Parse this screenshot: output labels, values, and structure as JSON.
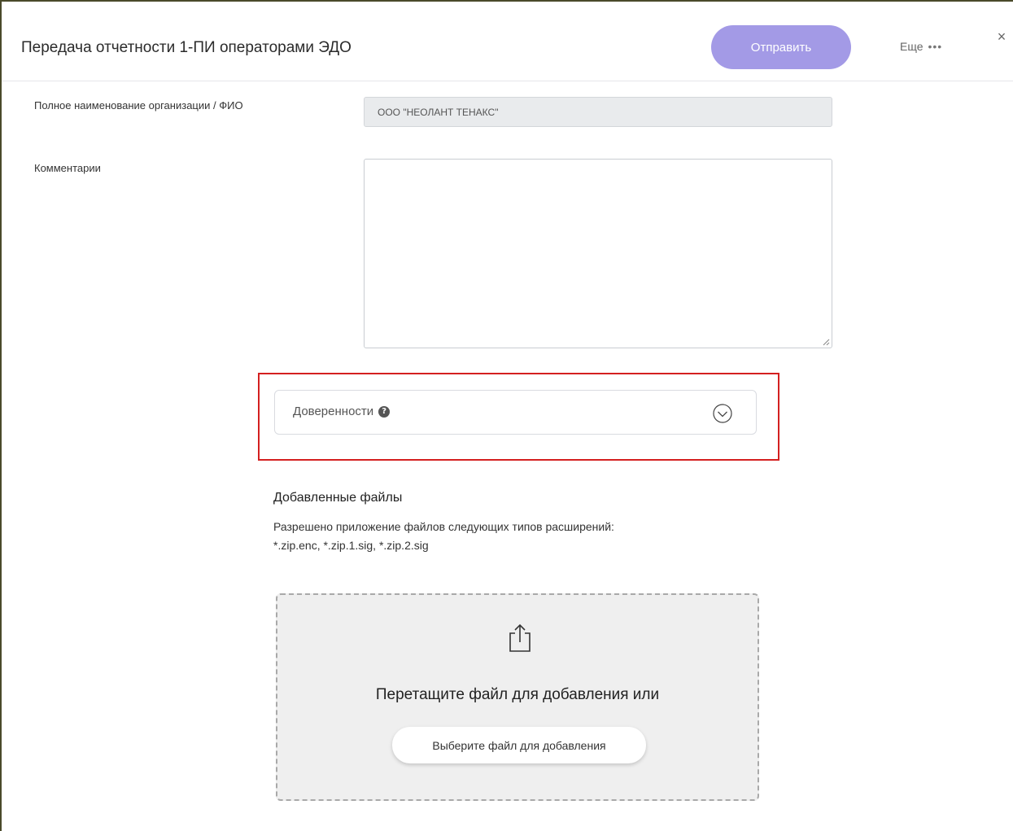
{
  "header": {
    "title": "Передача отчетности 1-ПИ операторами ЭДО",
    "send_label": "Отправить",
    "more_label": "Еще",
    "more_dots": "•••",
    "close_glyph": "×",
    "accent_color": "#a39ae6"
  },
  "form": {
    "org_label": "Полное наименование организации / ФИО",
    "org_value": "ООО \"НЕОЛАНТ ТЕНАКС\"",
    "comment_label": "Комментарии",
    "comment_value": ""
  },
  "poa": {
    "label": "Доверенности",
    "help_glyph": "?",
    "highlight_color": "#d42020"
  },
  "files": {
    "title": "Добавленные файлы",
    "desc_line1": "Разрешено приложение файлов следующих типов расширений:",
    "desc_line2": "*.zip.enc, *.zip.1.sig, *.zip.2.sig",
    "drop_text": "Перетащите файл для добавления или",
    "choose_label": "Выберите файл для добавления"
  }
}
